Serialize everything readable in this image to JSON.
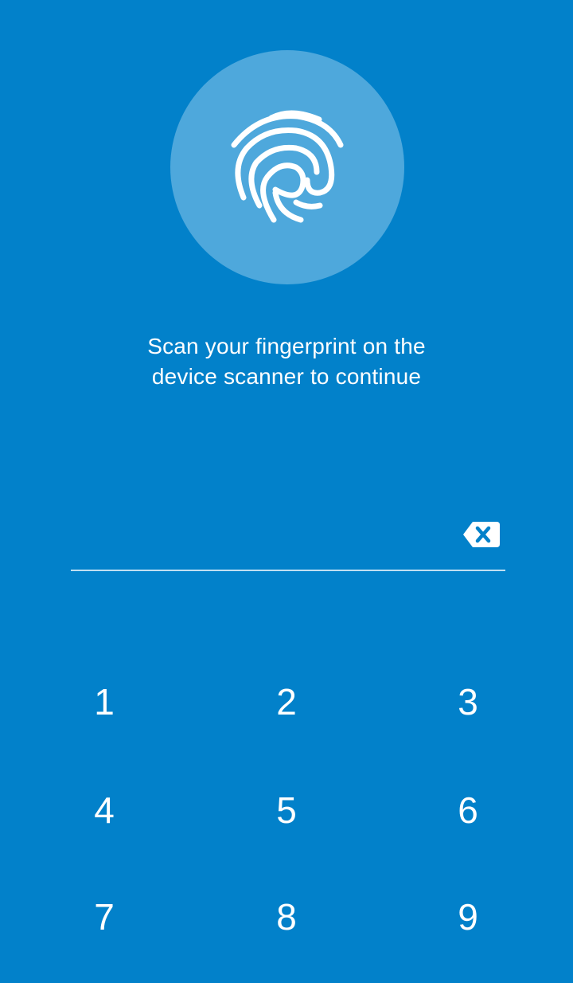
{
  "colors": {
    "background": "#0281ca",
    "circle": "#4ea8dc",
    "foreground": "#ffffff"
  },
  "fingerprint": {
    "icon": "fingerprint-icon"
  },
  "prompt": {
    "line1": "Scan your fingerprint on the",
    "line2": "device scanner to continue"
  },
  "pin": {
    "value": "",
    "backspace_icon": "backspace-icon"
  },
  "keypad": {
    "keys": [
      "1",
      "2",
      "3",
      "4",
      "5",
      "6",
      "7",
      "8",
      "9"
    ]
  }
}
